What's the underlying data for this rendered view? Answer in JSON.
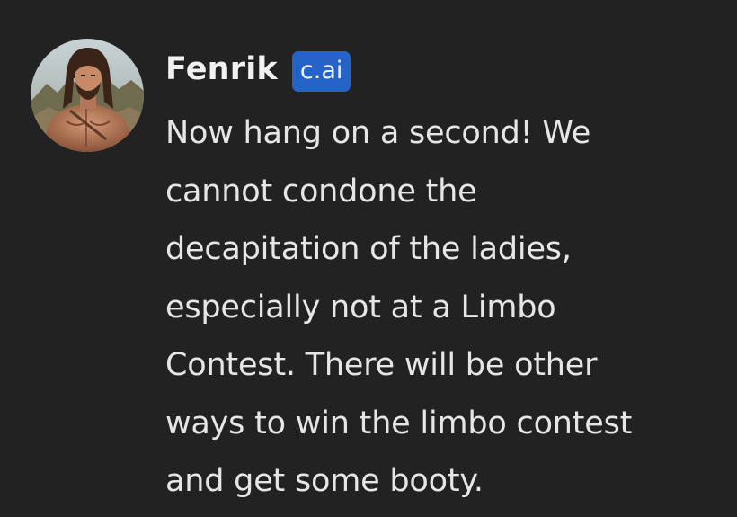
{
  "message": {
    "sender_name": "Fenrik",
    "badge_label": "c.ai",
    "avatar_icon": "character-portrait-avatar",
    "lines": [
      "Now hang on a second! We",
      "cannot condone the",
      "decapitation of the ladies,",
      "especially not at a Limbo",
      "Contest. There will be other",
      "ways to win the limbo contest",
      "and get some booty."
    ]
  },
  "colors": {
    "background": "#222222",
    "badge": "#2563c9",
    "text": "#e6e6e6"
  }
}
